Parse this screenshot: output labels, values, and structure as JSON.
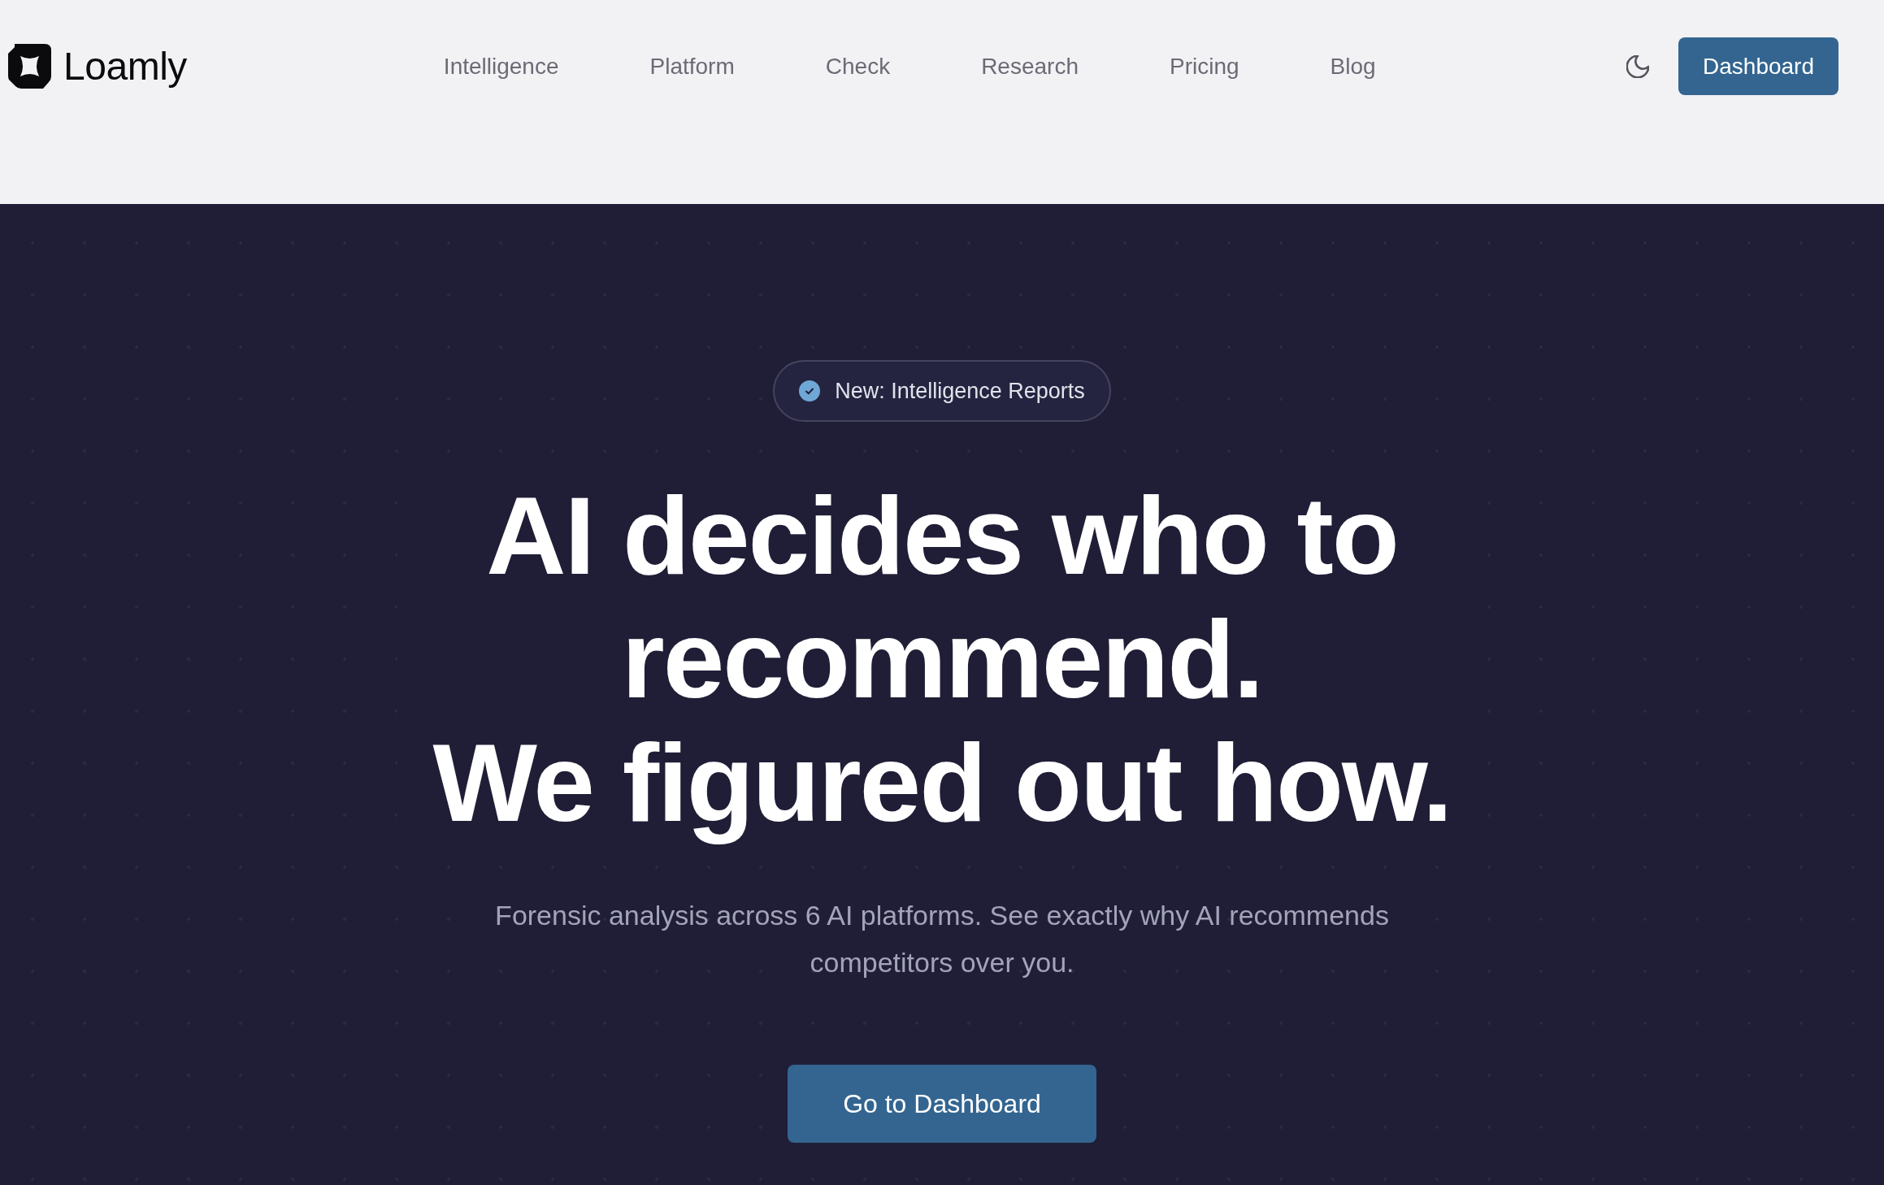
{
  "header": {
    "brand": "Loamly",
    "nav": [
      "Intelligence",
      "Platform",
      "Check",
      "Research",
      "Pricing",
      "Blog"
    ],
    "dashboard_button": "Dashboard"
  },
  "hero": {
    "badge": "New: Intelligence Reports",
    "headline": [
      "AI decides who to recommend.",
      "We figured out how."
    ],
    "subtitle": "Forensic analysis across 6 AI platforms. See exactly why AI recommends competitors over you.",
    "cta": "Go to Dashboard"
  }
}
